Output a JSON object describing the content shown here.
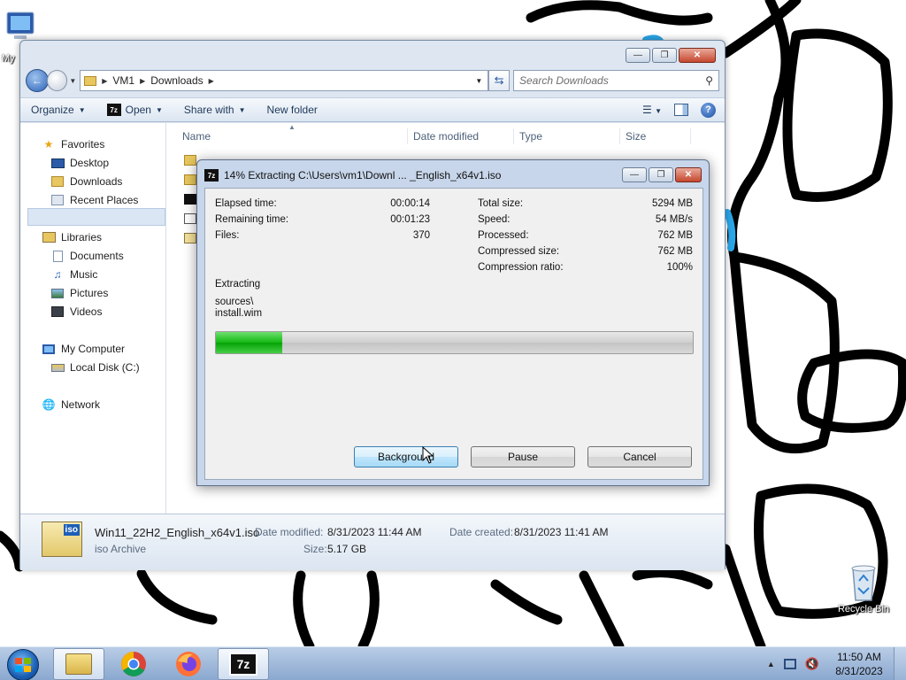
{
  "desktop": {
    "left_icon_label": "My",
    "recycle_bin_label": "Recycle Bin"
  },
  "explorer": {
    "breadcrumb": [
      "VM1",
      "Downloads"
    ],
    "search_placeholder": "Search Downloads",
    "toolbar": {
      "organize": "Organize",
      "open": "Open",
      "share_with": "Share with",
      "new_folder": "New folder"
    },
    "nav": {
      "favorites": "Favorites",
      "desktop": "Desktop",
      "downloads": "Downloads",
      "recent_places": "Recent Places",
      "libraries": "Libraries",
      "documents": "Documents",
      "music": "Music",
      "pictures": "Pictures",
      "videos": "Videos",
      "my_computer": "My Computer",
      "local_disk": "Local Disk (C:)",
      "network": "Network"
    },
    "columns": {
      "name": "Name",
      "date_modified": "Date modified",
      "type": "Type",
      "size": "Size"
    },
    "details": {
      "filename": "Win11_22H2_English_x64v1.iso",
      "filetype": "iso Archive",
      "date_modified_label": "Date modified:",
      "date_modified": "8/31/2023 11:44 AM",
      "date_created_label": "Date created:",
      "date_created": "8/31/2023 11:41 AM",
      "size_label": "Size:",
      "size": "5.17 GB"
    }
  },
  "zip_dialog": {
    "title": "14% Extracting C:\\Users\\vm1\\Downl ... _English_x64v1.iso",
    "left_stats": [
      {
        "label": "Elapsed time:",
        "value": "00:00:14"
      },
      {
        "label": "Remaining time:",
        "value": "00:01:23"
      },
      {
        "label": "Files:",
        "value": "370"
      }
    ],
    "right_stats": [
      {
        "label": "Total size:",
        "value": "5294 MB"
      },
      {
        "label": "Speed:",
        "value": "54 MB/s"
      },
      {
        "label": "Processed:",
        "value": "762 MB"
      },
      {
        "label": "Compressed size:",
        "value": "762 MB"
      },
      {
        "label": "Compression ratio:",
        "value": "100%"
      }
    ],
    "status": "Extracting",
    "current_path": "sources\\",
    "current_file": "install.wim",
    "progress_fraction": 0.14,
    "buttons": {
      "background": "Background",
      "pause": "Pause",
      "cancel": "Cancel"
    }
  },
  "taskbar": {
    "time": "11:50 AM",
    "date": "8/31/2023"
  },
  "colors": {
    "progress_green": "#12b812",
    "accent_blue": "#2a62b8"
  }
}
